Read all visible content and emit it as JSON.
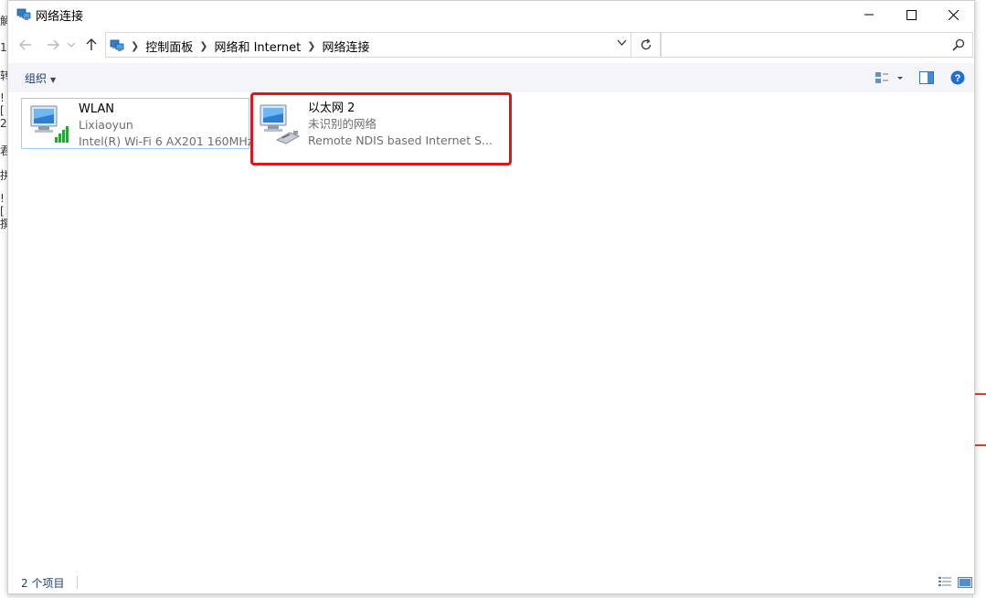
{
  "window": {
    "title": "网络连接",
    "icon": "network-connections-icon"
  },
  "navigation": {
    "back_icon": "arrow-left-icon",
    "forward_icon": "arrow-right-icon",
    "recent_icon": "chevron-down-icon",
    "up_icon": "arrow-up-icon",
    "breadcrumbs": [
      "控制面板",
      "网络和 Internet",
      "网络连接"
    ],
    "refresh_icon": "refresh-icon"
  },
  "search": {
    "placeholder": ""
  },
  "commandbar": {
    "organize_label": "组织",
    "view_icon": "change-view-icon",
    "preview_icon": "preview-pane-icon",
    "help_icon": "help-icon"
  },
  "connections": [
    {
      "name": "WLAN",
      "network": "Lixiaoyun",
      "device": "Intel(R) Wi-Fi 6 AX201 160MHz",
      "icon": "wifi-adapter-icon"
    },
    {
      "name": "以太网 2",
      "network": "未识别的网络",
      "device": "Remote NDIS based Internet S...",
      "icon": "ethernet-adapter-icon"
    }
  ],
  "statusbar": {
    "item_count": "2 个项目"
  },
  "colors": {
    "highlight": "#e0151b",
    "selection_border": "#99d1f4",
    "link_text": "#1a3e6f"
  }
}
